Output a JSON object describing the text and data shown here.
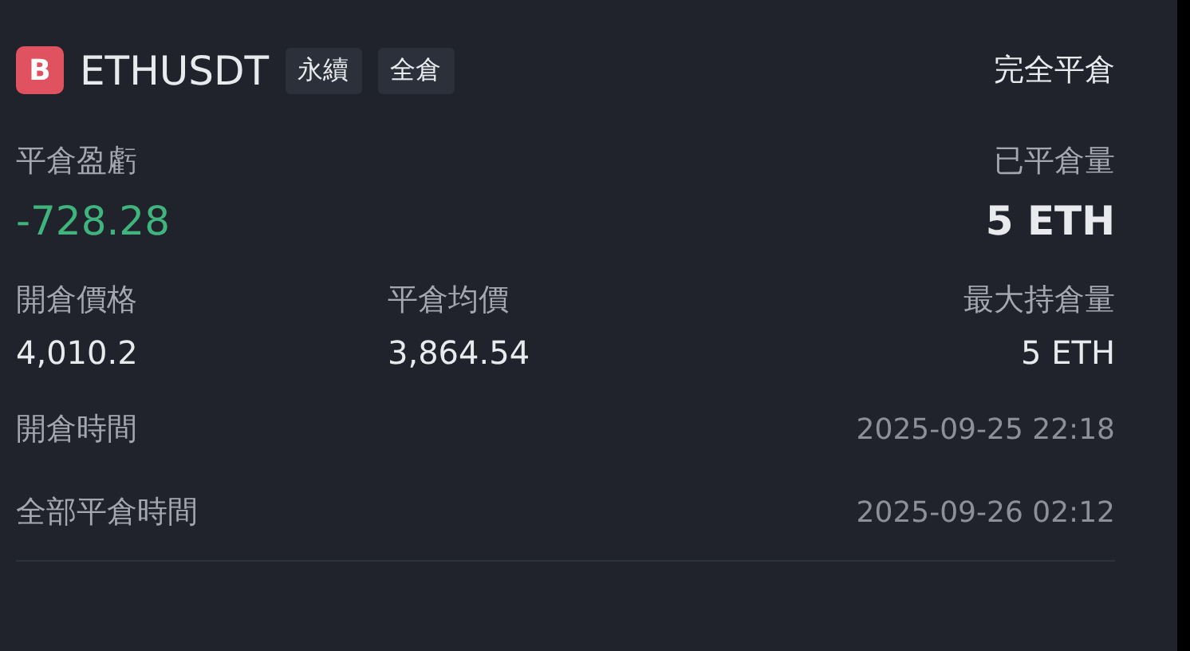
{
  "header": {
    "side_badge": "B",
    "symbol": "ETHUSDT",
    "tags": [
      "永續",
      "全倉"
    ],
    "status": "完全平倉"
  },
  "summary": {
    "pnl_label": "平倉盈虧",
    "pnl": "-728.28",
    "closed_label": "已平倉量",
    "closed": "5 ETH"
  },
  "prices": [
    {
      "label": "開倉價格",
      "value": "4,010.2"
    },
    {
      "label": "平倉均價",
      "value": "3,864.54"
    },
    {
      "label": "最大持倉量",
      "value": "5 ETH"
    }
  ],
  "times": [
    {
      "label": "開倉時間",
      "value": "2025-09-25 22:18"
    },
    {
      "label": "全部平倉時間",
      "value": "2025-09-26 02:12"
    }
  ]
}
